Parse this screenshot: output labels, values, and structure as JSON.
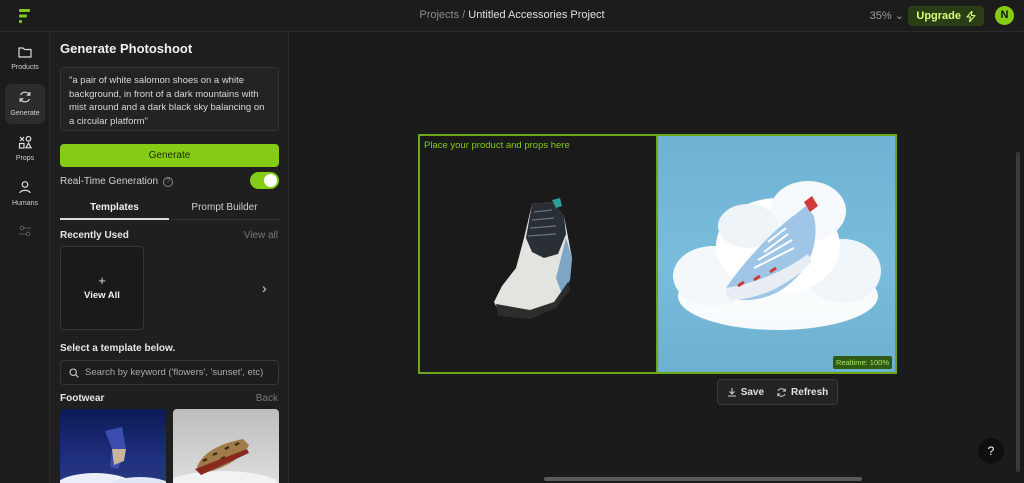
{
  "topbar": {
    "breadcrumb_root": "Projects",
    "breadcrumb_sep": " / ",
    "breadcrumb_current": "Untitled Accessories Project",
    "zoom": "35%",
    "upgrade_label": "Upgrade",
    "avatar_initial": "N"
  },
  "rail": {
    "items": [
      {
        "label": "Products",
        "icon": "folder-icon"
      },
      {
        "label": "Generate",
        "icon": "refresh-icon"
      },
      {
        "label": "Props",
        "icon": "shapes-icon"
      },
      {
        "label": "Humans",
        "icon": "person-icon"
      },
      {
        "label": "",
        "icon": "sliders-icon"
      }
    ]
  },
  "panel": {
    "title": "Generate Photoshoot",
    "prompt_text": "\"a pair of white salomon shoes on a white background, in front of a dark mountains with mist around and a dark black sky balancing on a circular platform\"",
    "generate_label": "Generate",
    "realtime_label": "Real-Time Generation",
    "realtime_on": true,
    "tabs": [
      {
        "label": "Templates",
        "active": true
      },
      {
        "label": "Prompt Builder",
        "active": false
      }
    ],
    "recently_used_label": "Recently Used",
    "view_all_link": "View all",
    "view_all_card": "View All",
    "select_template_label": "Select a template below.",
    "search_placeholder": "Search by keyword ('flowers', 'sunset', etc)",
    "category_label": "Footwear",
    "back_label": "Back"
  },
  "canvas": {
    "place_hint": "Place your product and props here",
    "realtime_badge": "Realtime: 100%",
    "save_label": "Save",
    "refresh_label": "Refresh",
    "help_label": "?"
  },
  "colors": {
    "accent": "#84cc16",
    "background": "#1b1b1b",
    "panel": "#1f1f1f"
  }
}
